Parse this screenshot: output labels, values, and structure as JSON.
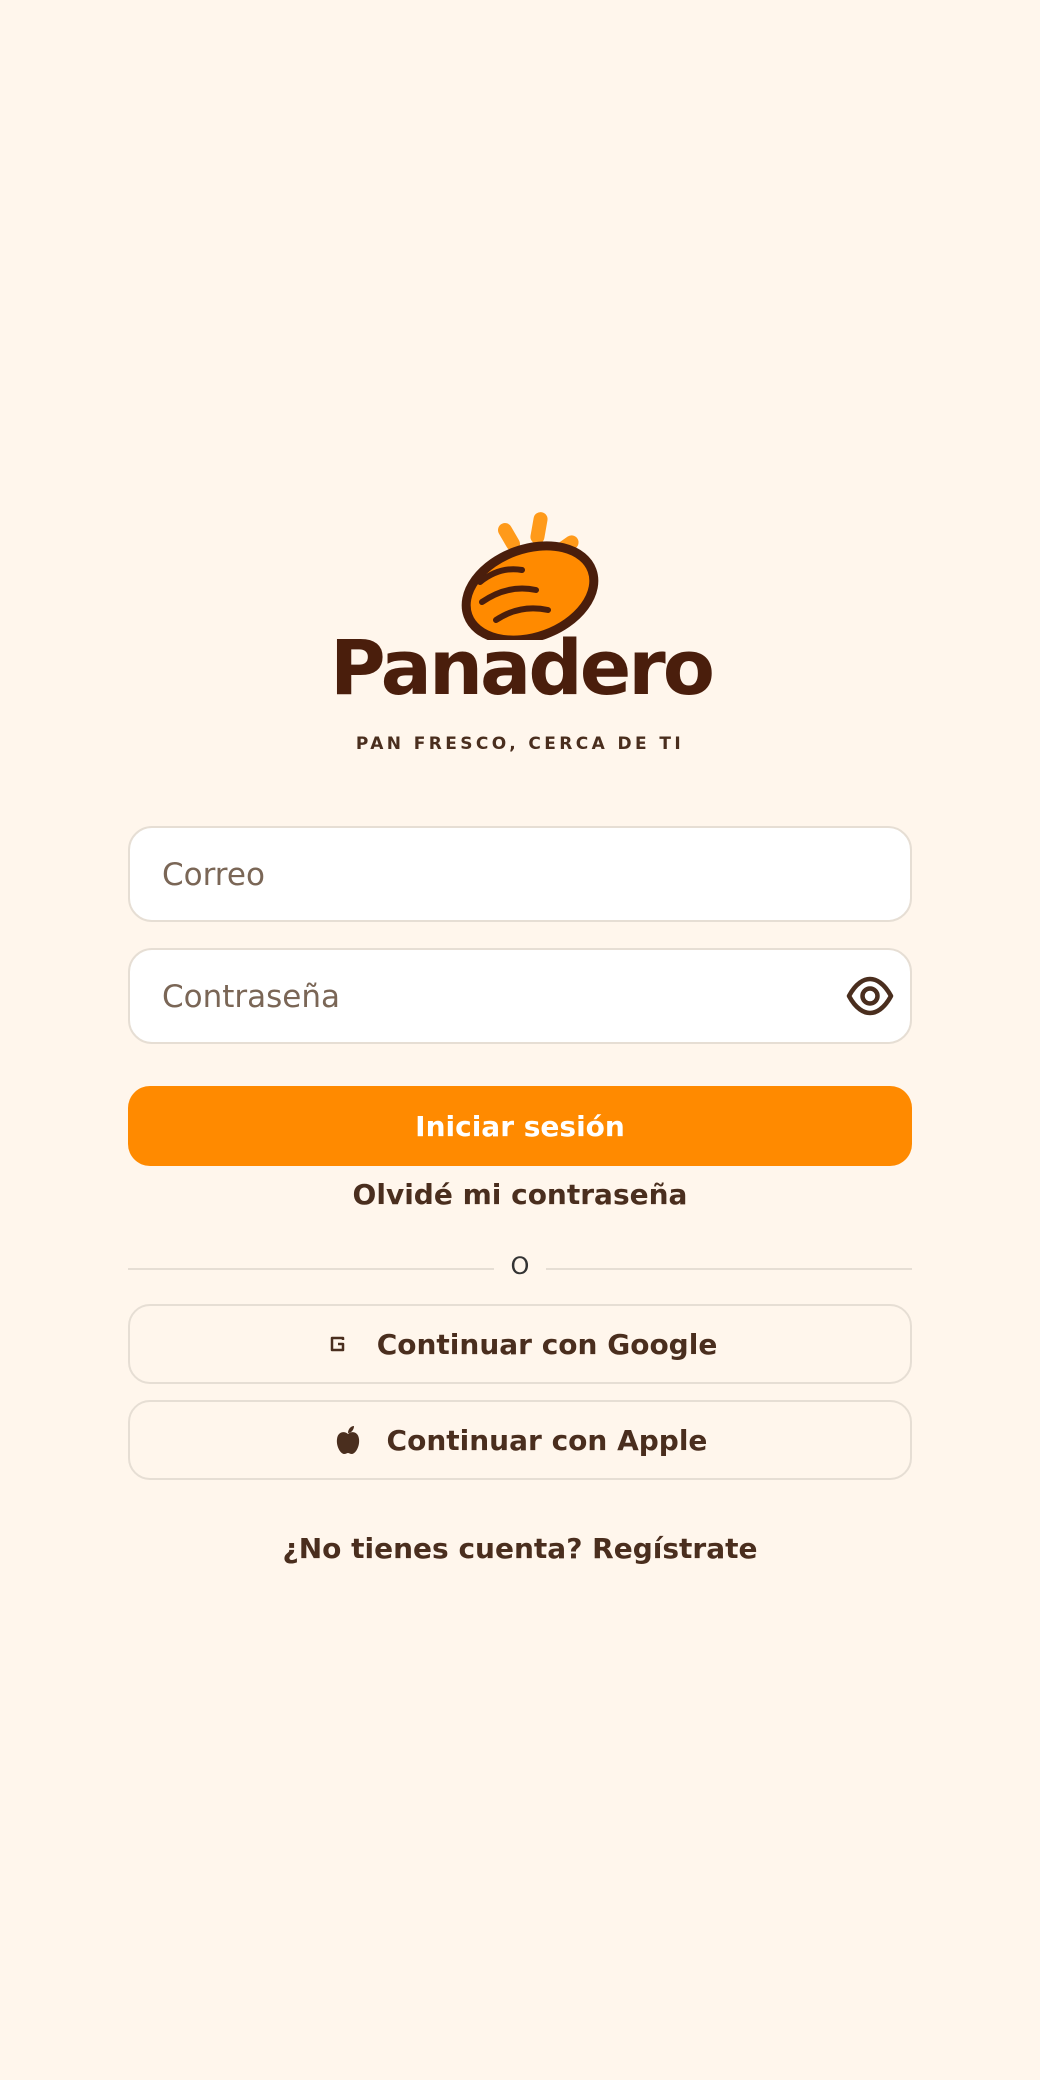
{
  "brand": {
    "name": "Panadero",
    "tagline": "PAN FRESCO, CERCA DE TI",
    "logo_icon": "bread-icon",
    "colors": {
      "accent": "#ff8a00",
      "text": "#4a2e1e",
      "background": "#fff6ec",
      "wordmark": "#4a1e0c"
    }
  },
  "form": {
    "email_placeholder": "Correo",
    "email_value": "",
    "password_placeholder": "Contraseña",
    "password_value": "",
    "password_toggle_icon": "eye-icon",
    "submit_label": "Iniciar sesión",
    "forgot_label": "Olvidé mi contraseña"
  },
  "divider": {
    "label": "O"
  },
  "social": {
    "google_label": "Continuar con Google",
    "google_icon": "google-icon",
    "apple_label": "Continuar con Apple",
    "apple_icon": "apple-icon"
  },
  "footer": {
    "register_label": "¿No tienes cuenta? Regístrate"
  }
}
